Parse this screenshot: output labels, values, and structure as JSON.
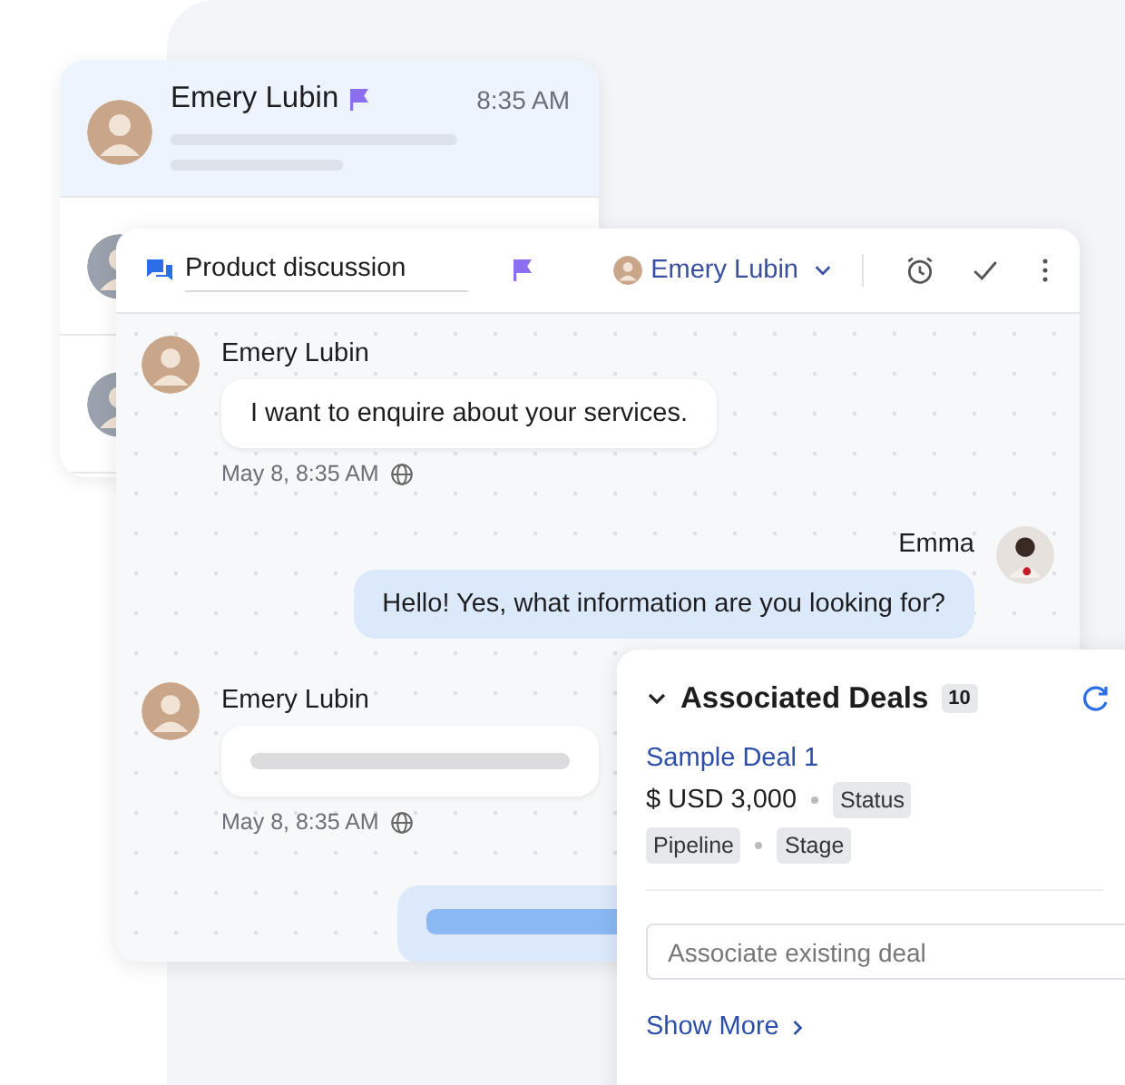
{
  "conversation_list": {
    "items": [
      {
        "name": "Emery Lubin",
        "flagged": true,
        "time": "8:35 AM",
        "selected": true
      },
      {
        "selected": false
      },
      {
        "selected": false
      }
    ]
  },
  "chat": {
    "subject": "Product discussion",
    "flagged": true,
    "assignee": "Emery Lubin",
    "messages": [
      {
        "kind": "incoming",
        "sender": "Emery Lubin",
        "text": "I want to enquire about your services.",
        "time": "May 8, 8:35 AM"
      },
      {
        "kind": "outgoing",
        "sender": "Emma",
        "text": "Hello! Yes, what information are you looking for?"
      },
      {
        "kind": "incoming",
        "sender": "Emery Lubin",
        "time": "May 8, 8:35 AM"
      },
      {
        "kind": "outgoing"
      }
    ]
  },
  "deals_panel": {
    "title": "Associated Deals",
    "count": "10",
    "expanded": true,
    "deals": [
      {
        "name": "Sample Deal 1",
        "amount": "$ USD 3,000",
        "status": "Status",
        "pipeline": "Pipeline",
        "stage": "Stage"
      }
    ],
    "search": {
      "placeholder": "Associate existing deal"
    },
    "show_more": "Show More"
  }
}
